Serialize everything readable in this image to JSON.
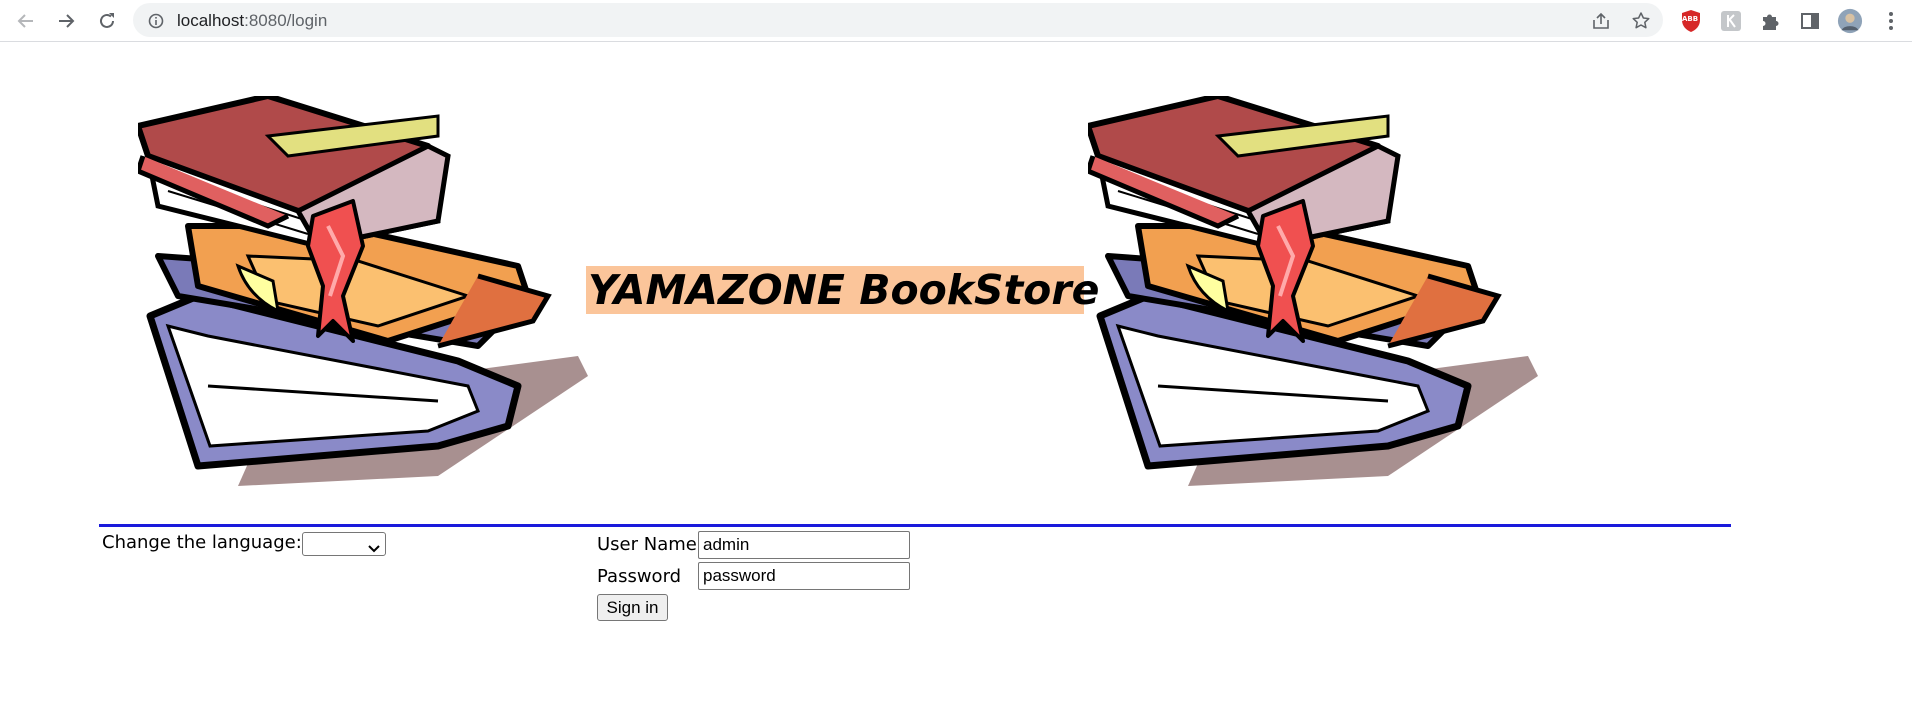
{
  "browser": {
    "url_host": "localhost",
    "url_rest": ":8080/login",
    "extension_badge": "ABB",
    "colors": {
      "toolbar_bg": "#ffffff",
      "omnibox_bg": "#f1f3f4",
      "icon": "#5f6368"
    },
    "icons": [
      "back-icon",
      "forward-icon",
      "reload-icon",
      "site-info-icon",
      "share-icon",
      "bookmark-star-icon",
      "extension-shield-icon",
      "extension-icon",
      "puzzle-icon",
      "side-panel-icon",
      "profile-avatar",
      "kebab-menu-icon"
    ]
  },
  "page": {
    "title": "YAMAZONE BookStore",
    "language_label": "Change the language:",
    "language_selected": "",
    "form": {
      "username_label": "User Name",
      "username_value": "admin",
      "password_label": "Password",
      "password_value": "password",
      "submit_label": "Sign in"
    },
    "colors": {
      "title_bg": "#fbc59a",
      "divider": "#1a1adb"
    }
  }
}
